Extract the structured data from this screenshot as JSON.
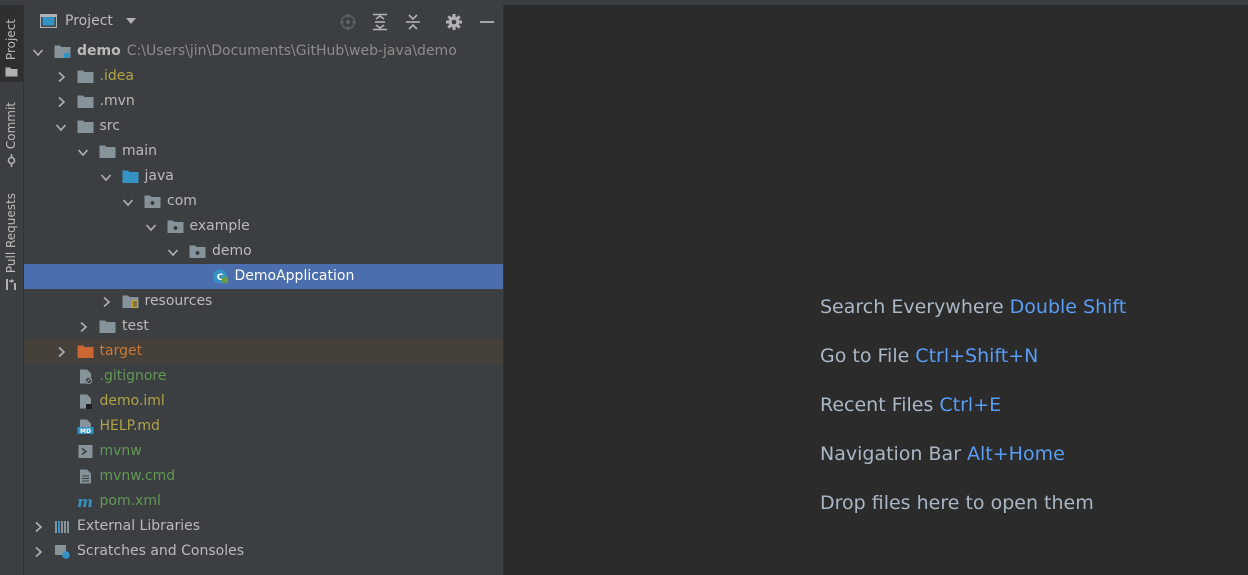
{
  "stripe": {
    "project_label": "Project",
    "commit_label": "Commit",
    "pull_requests_label": "Pull Requests"
  },
  "panel": {
    "title": "Project"
  },
  "tree": [
    {
      "label": "demo",
      "path": "C:\\Users\\jin\\Documents\\GitHub\\web-java\\demo",
      "depth": 0,
      "expanded": true,
      "icon": "module-folder-icon",
      "color": "default",
      "bold": true
    },
    {
      "label": ".idea",
      "depth": 1,
      "expanded": false,
      "icon": "folder-icon",
      "color": "olive"
    },
    {
      "label": ".mvn",
      "depth": 1,
      "expanded": false,
      "icon": "folder-icon",
      "color": "default"
    },
    {
      "label": "src",
      "depth": 1,
      "expanded": true,
      "icon": "folder-icon",
      "color": "default"
    },
    {
      "label": "main",
      "depth": 2,
      "expanded": true,
      "icon": "folder-icon",
      "color": "default"
    },
    {
      "label": "java",
      "depth": 3,
      "expanded": true,
      "icon": "source-folder-icon",
      "color": "default"
    },
    {
      "label": "com",
      "depth": 4,
      "expanded": true,
      "icon": "package-icon",
      "color": "default"
    },
    {
      "label": "example",
      "depth": 5,
      "expanded": true,
      "icon": "package-icon",
      "color": "default"
    },
    {
      "label": "demo",
      "depth": 6,
      "expanded": true,
      "icon": "package-icon",
      "color": "default"
    },
    {
      "label": "DemoApplication",
      "depth": 7,
      "expanded": null,
      "icon": "spring-class-icon",
      "color": "white",
      "selected": true
    },
    {
      "label": "resources",
      "depth": 3,
      "expanded": false,
      "icon": "resources-folder-icon",
      "color": "default"
    },
    {
      "label": "test",
      "depth": 2,
      "expanded": false,
      "icon": "folder-icon",
      "color": "default"
    },
    {
      "label": "target",
      "depth": 1,
      "expanded": false,
      "icon": "excluded-folder-icon",
      "color": "orange",
      "excluded": true
    },
    {
      "label": ".gitignore",
      "depth": 1,
      "expanded": null,
      "icon": "gitignore-file-icon",
      "color": "green"
    },
    {
      "label": "demo.iml",
      "depth": 1,
      "expanded": null,
      "icon": "iml-file-icon",
      "color": "olive"
    },
    {
      "label": "HELP.md",
      "depth": 1,
      "expanded": null,
      "icon": "markdown-file-icon",
      "color": "olive"
    },
    {
      "label": "mvnw",
      "depth": 1,
      "expanded": null,
      "icon": "shell-file-icon",
      "color": "green"
    },
    {
      "label": "mvnw.cmd",
      "depth": 1,
      "expanded": null,
      "icon": "text-file-icon",
      "color": "green"
    },
    {
      "label": "pom.xml",
      "depth": 1,
      "expanded": null,
      "icon": "maven-icon",
      "color": "green"
    },
    {
      "label": "External Libraries",
      "depth": 0,
      "expanded": false,
      "icon": "libraries-icon",
      "color": "default"
    },
    {
      "label": "Scratches and Consoles",
      "depth": 0,
      "expanded": false,
      "icon": "scratches-icon",
      "color": "default"
    }
  ],
  "hints": [
    {
      "text": "Search Everywhere",
      "key": "Double Shift"
    },
    {
      "text": "Go to File",
      "key": "Ctrl+Shift+N"
    },
    {
      "text": "Recent Files",
      "key": "Ctrl+E"
    },
    {
      "text": "Navigation Bar",
      "key": "Alt+Home"
    },
    {
      "text": "Drop files here to open them",
      "key": ""
    }
  ],
  "colors": {
    "selection": "#4b6eaf",
    "shortcut": "#589df6",
    "folder": "#87939a",
    "source_folder": "#3592c4",
    "excluded_folder": "#cc6633"
  }
}
